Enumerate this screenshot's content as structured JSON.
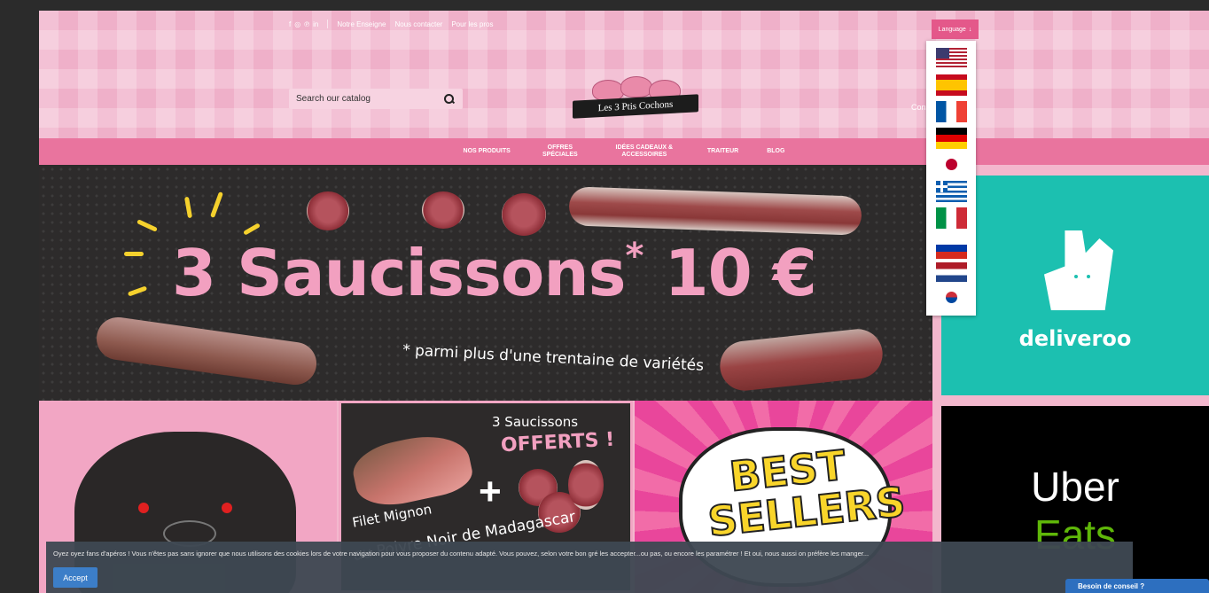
{
  "topbar": {
    "social": [
      "f",
      "◎",
      "℗",
      "in"
    ],
    "links": [
      "Notre Enseigne",
      "Nous contacter",
      "Pour les pros"
    ]
  },
  "search": {
    "placeholder": "Search our catalog"
  },
  "logo": {
    "text": "Les 3 Ptis Cochons"
  },
  "language": {
    "label": "Language",
    "flags": [
      "us",
      "es",
      "fr",
      "de",
      "jp",
      "gr",
      "it",
      "ru",
      "nl",
      "kr"
    ]
  },
  "account": {
    "text": "Con                 er"
  },
  "nav": [
    {
      "label": "NOS PRODUITS"
    },
    {
      "label": "OFFRES SPÉCIALES"
    },
    {
      "label": "IDÉES CADEAUX & ACCESSOIRES"
    },
    {
      "label": "TRAITEUR"
    },
    {
      "label": "BLOG"
    }
  ],
  "hero": {
    "headline": "3 Saucissons",
    "star": "*",
    "price": " 10 €",
    "sub": "* parmi plus d'une trentaine de variétés"
  },
  "tile2": {
    "line1": "3 Saucissons",
    "line2": "OFFERTS !",
    "line3": "Filet Mignon",
    "line4": "au Poivre Noir de Madagascar"
  },
  "tile3": {
    "text1": "BEST",
    "text2": "SELLERS"
  },
  "sidebar": {
    "deliveroo": "deliveroo",
    "uber1": "Uber",
    "uber2": "Eats"
  },
  "cookie": {
    "message": "Oyez oyez fans d'apéros ! Vous n'êtes pas sans ignorer que nous utilisons des cookies lors de votre navigation pour vous proposer du contenu adapté. Vous pouvez, selon votre bon gré les accepter...ou pas, ou encore les paramétrer ! Et oui, nous aussi on préfère les manger...",
    "accept": "Accept"
  },
  "chat": {
    "label": "Besoin de conseil ?"
  },
  "colors": {
    "pink": "#e9749e",
    "accept_blue": "#3c7ec8",
    "deliveroo": "#1cc0b0"
  }
}
